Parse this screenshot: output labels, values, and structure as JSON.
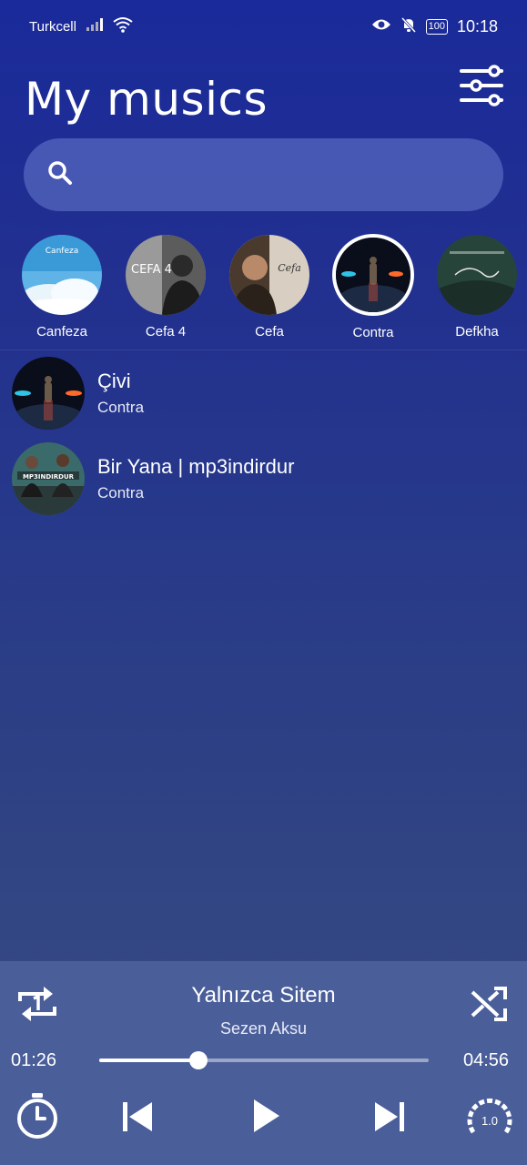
{
  "status": {
    "carrier": "Turkcell",
    "battery": "100",
    "time": "10:18"
  },
  "header": {
    "title": "My musics"
  },
  "search": {
    "placeholder": ""
  },
  "artists": [
    {
      "name": "Canfeza",
      "cover_text": "Canfeza"
    },
    {
      "name": "Cefa 4",
      "cover_text": "CEFA 4"
    },
    {
      "name": "Cefa",
      "cover_text": "Cefa"
    },
    {
      "name": "Contra",
      "selected": true
    },
    {
      "name": "Defkha",
      "cover_text": ""
    }
  ],
  "songs": [
    {
      "title": "Çivi",
      "artist": "Contra"
    },
    {
      "title": "Bir Yana | mp3indirdur",
      "artist": "Contra",
      "cover_text": "MP3INDIRDUR"
    }
  ],
  "player": {
    "title": "Yalnızca Sitem",
    "artist": "Sezen Aksu",
    "current": "01:26",
    "total": "04:56",
    "progress": 0.3,
    "speed": "1.0"
  },
  "colors": {
    "accent": "#ffffff",
    "player_bg": "#4a5e9a",
    "search_bg": "#5a6ac4"
  }
}
